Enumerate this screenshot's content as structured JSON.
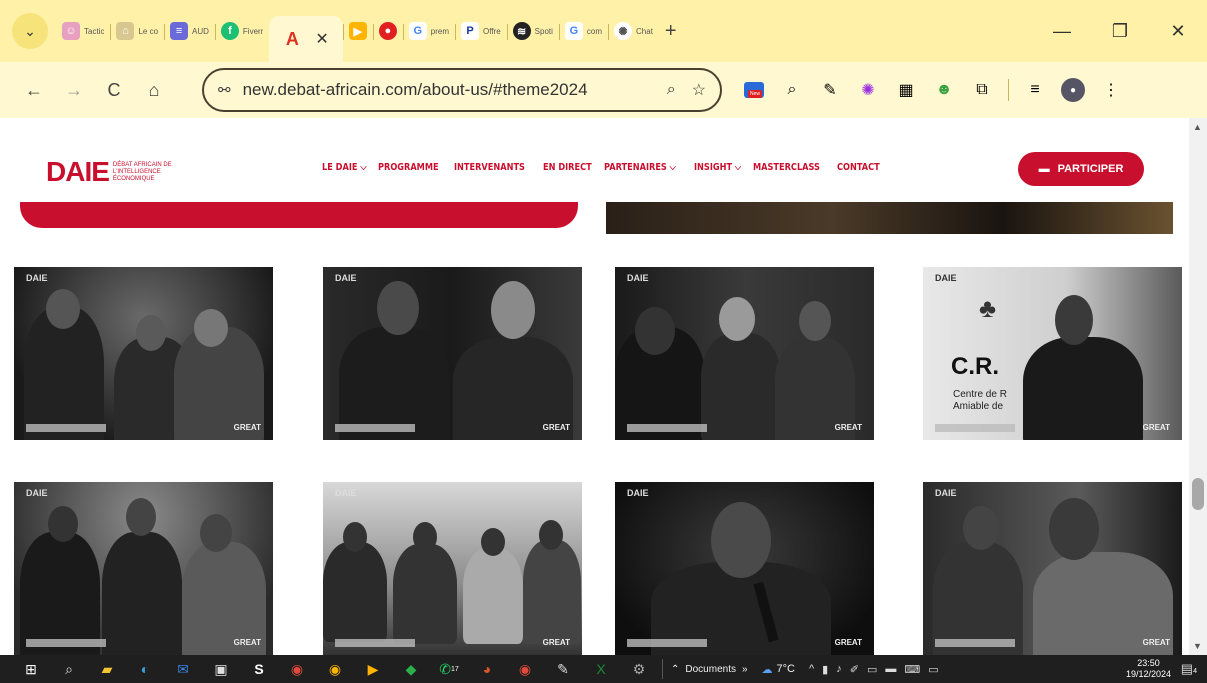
{
  "tabs": [
    {
      "label": "Tactic",
      "icon": "people-icon",
      "color": "#e8a0c0"
    },
    {
      "label": "Le co",
      "icon": "blocks-icon",
      "color": "#d8c890"
    },
    {
      "label": "AUD",
      "icon": "docs-icon",
      "color": "#6a6ad8"
    },
    {
      "label": "Fiverr",
      "icon": "fiverr-icon",
      "color": "#1dbf73"
    },
    {
      "label": "",
      "icon": "acrobat-icon",
      "color": "#e03020",
      "active": true
    },
    {
      "label": "",
      "icon": "meet-icon",
      "color": "#ffb400"
    },
    {
      "label": "",
      "icon": "record-icon",
      "color": "#e02020"
    },
    {
      "label": "prem",
      "icon": "google-icon",
      "color": "#4285f4"
    },
    {
      "label": "Offre",
      "icon": "paypal-icon",
      "color": "#1a3a9a"
    },
    {
      "label": "Spoti",
      "icon": "spotify-icon",
      "color": "#222222"
    },
    {
      "label": "com",
      "icon": "google-icon",
      "color": "#4285f4"
    },
    {
      "label": "Chat",
      "icon": "chatgpt-icon",
      "color": "#555555"
    }
  ],
  "new_tab_glyph": "+",
  "window": {
    "minimize": "—",
    "restore": "❐",
    "close": "✕"
  },
  "toolbar": {
    "back": "←",
    "forward": "→",
    "reload": "C",
    "home": "⌂",
    "url": "new.debat-africain.com/about-us/#theme2024",
    "new_badge": "New"
  },
  "site": {
    "logo_word": "DAIE",
    "logo_sub": "DÉBAT AFRICAIN DE L'INTELLIGENCE ÉCONOMIQUE",
    "nav": [
      "LE DAIE ⌵",
      "PROGRAMME",
      "INTERVENANTS",
      "EN DIRECT",
      "PARTENAIRES ⌵",
      "INSIGHT ⌵",
      "MASTERCLASS",
      "CONTACT"
    ],
    "cta": "PARTICIPER"
  },
  "photos": {
    "logo": "DAIE",
    "great": "GREAT",
    "cr_title": "C.R.",
    "cr_sub": "Centre de R\nAmiable de"
  },
  "taskbar": {
    "search_glyph": "⌕",
    "documents": "Documents",
    "weather": "7°C",
    "time": "23:50",
    "date": "19/12/2024",
    "whatsapp_badge": "17",
    "notif_badge": "4"
  }
}
